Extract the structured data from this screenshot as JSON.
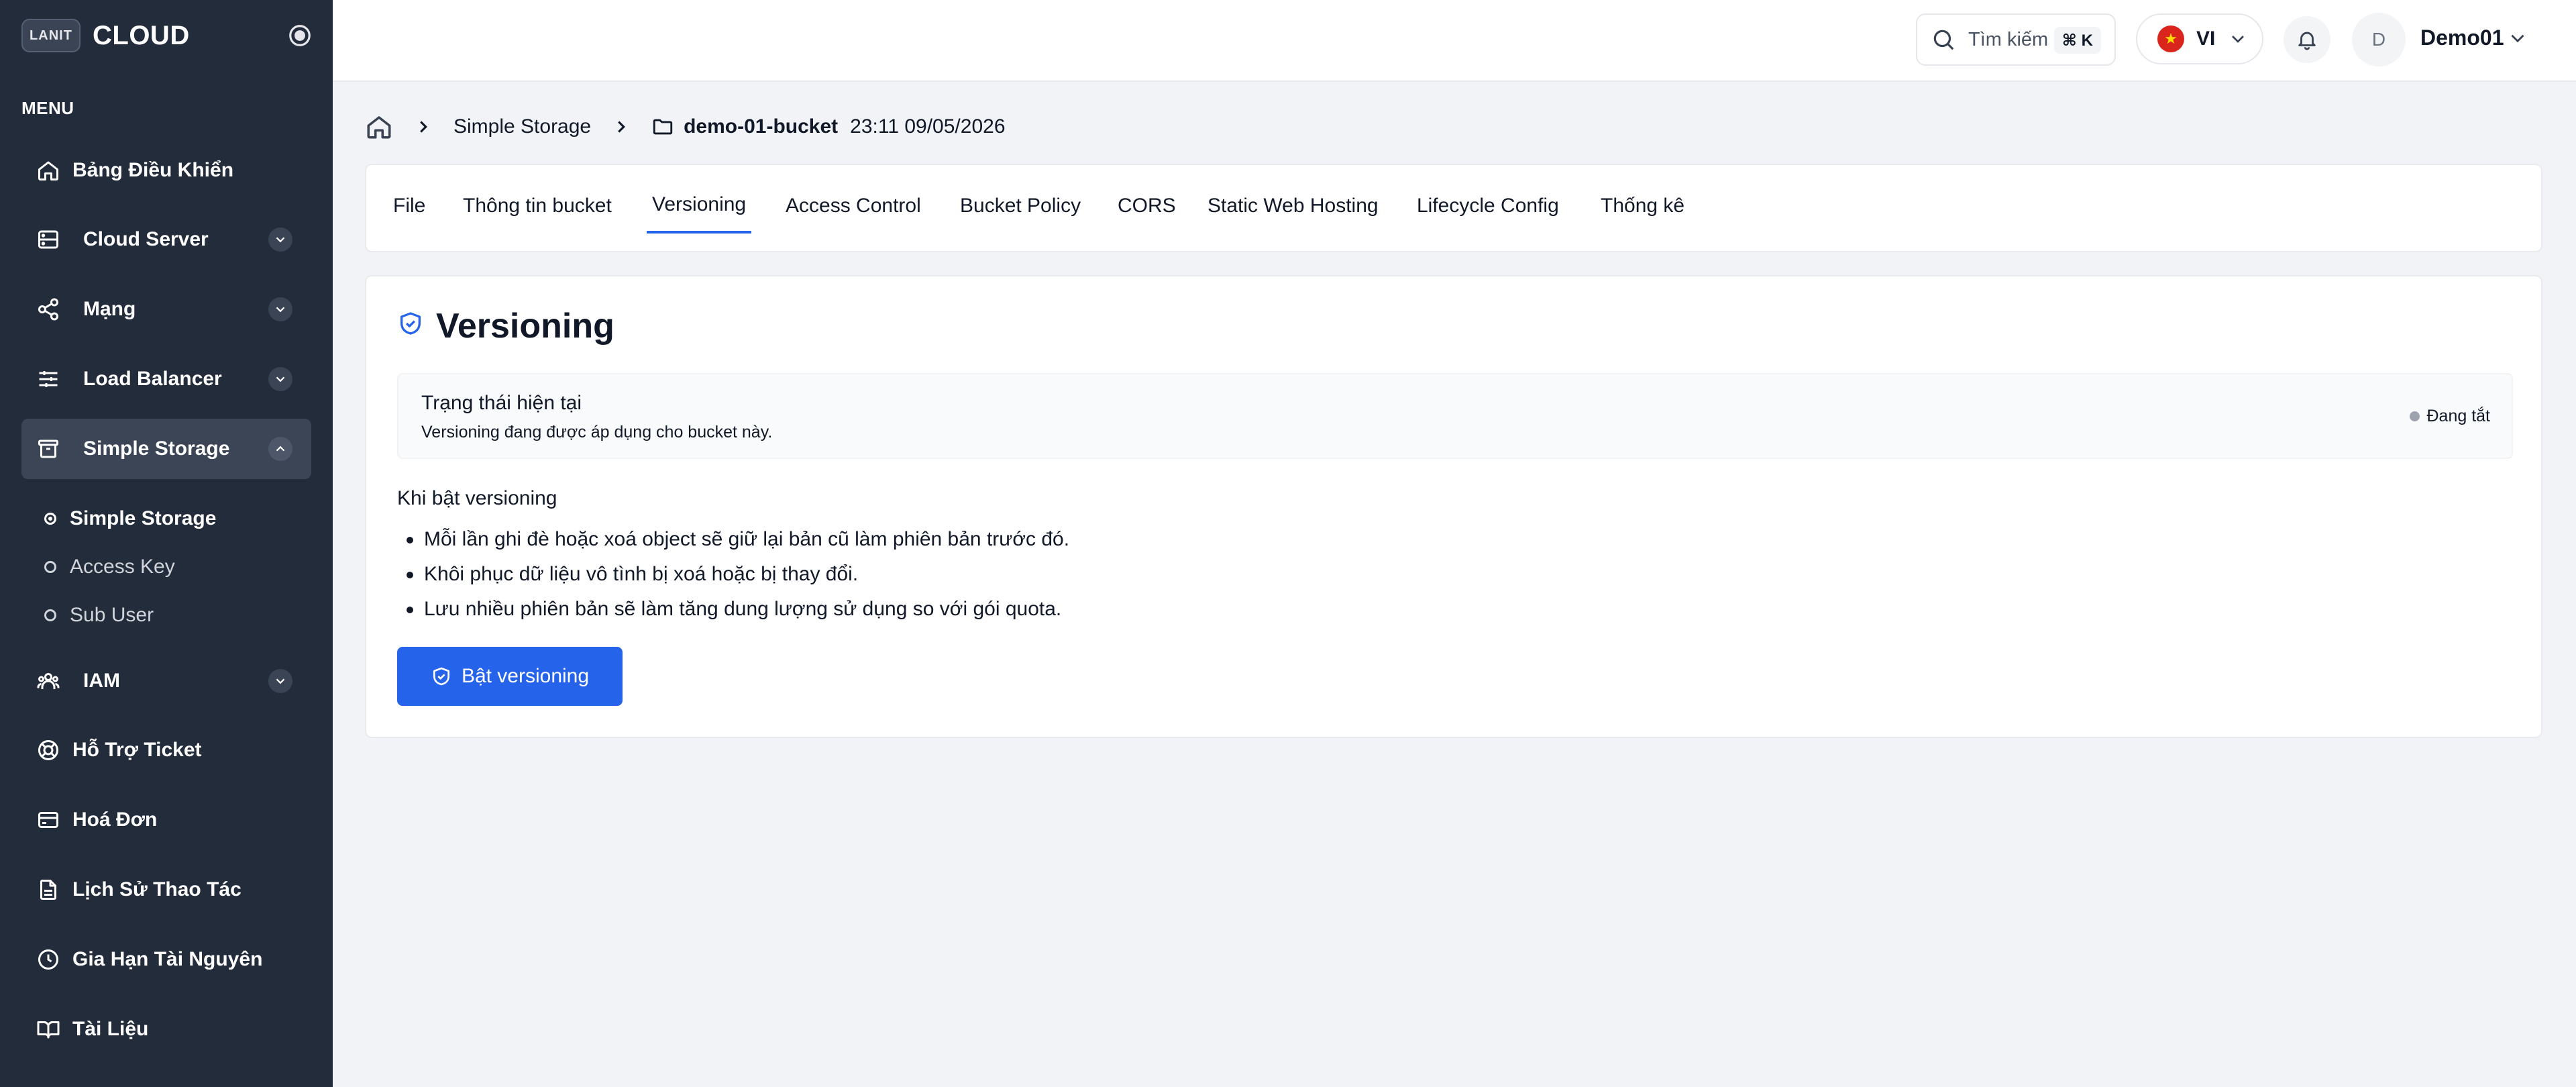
{
  "sidebar": {
    "brand_logo": "LANIT",
    "brand_name": "CLOUD",
    "menu_label": "MENU",
    "items": [
      {
        "label": "Bảng Điều Khiển",
        "icon": "home-icon"
      },
      {
        "label": "Cloud Server",
        "icon": "server-icon"
      },
      {
        "label": "Mạng",
        "icon": "share-icon"
      },
      {
        "label": "Load Balancer",
        "icon": "sliders-icon"
      },
      {
        "label": "Simple Storage",
        "icon": "archive-icon"
      },
      {
        "label": "IAM",
        "icon": "users-icon"
      },
      {
        "label": "Hỗ Trợ Ticket",
        "icon": "lifebuoy-icon"
      },
      {
        "label": "Hoá Đơn",
        "icon": "credit-card-icon"
      },
      {
        "label": "Lịch Sử Thao Tác",
        "icon": "file-text-icon"
      },
      {
        "label": "Gia Hạn Tài Nguyên",
        "icon": "clock-icon"
      },
      {
        "label": "Tài Liệu",
        "icon": "book-icon"
      }
    ],
    "sub_items": [
      {
        "label": "Simple Storage"
      },
      {
        "label": "Access Key"
      },
      {
        "label": "Sub User"
      }
    ]
  },
  "topbar": {
    "search_placeholder": "Tìm kiếm",
    "search_shortcut": "⌘ K",
    "language": "VI",
    "avatar_initial": "D",
    "user_name": "Demo01"
  },
  "breadcrumb": {
    "section": "Simple Storage",
    "bucket": "demo-01-bucket",
    "time": "23:11 09/05/2026"
  },
  "tabs": [
    {
      "label": "File"
    },
    {
      "label": "Thông tin bucket"
    },
    {
      "label": "Versioning"
    },
    {
      "label": "Access Control"
    },
    {
      "label": "Bucket Policy"
    },
    {
      "label": "CORS"
    },
    {
      "label": "Static Web Hosting"
    },
    {
      "label": "Lifecycle Config"
    },
    {
      "label": "Thống kê"
    }
  ],
  "versioning": {
    "title": "Versioning",
    "status_title": "Trạng thái hiện tại",
    "status_desc": "Versioning đang được áp dụng cho bucket này.",
    "status_badge": "Đang tắt",
    "status_color": "#9ca3af",
    "when_title": "Khi bật versioning",
    "bullets": [
      "Mỗi lần ghi đè hoặc xoá object sẽ giữ lại bản cũ làm phiên bản trước đó.",
      "Khôi phục dữ liệu vô tình bị xoá hoặc bị thay đổi.",
      "Lưu nhiều phiên bản sẽ làm tăng dung lượng sử dụng so với gói quota."
    ],
    "enable_button": "Bật versioning"
  },
  "colors": {
    "sidebar_bg": "#232c3b",
    "accent": "#2563eb"
  }
}
